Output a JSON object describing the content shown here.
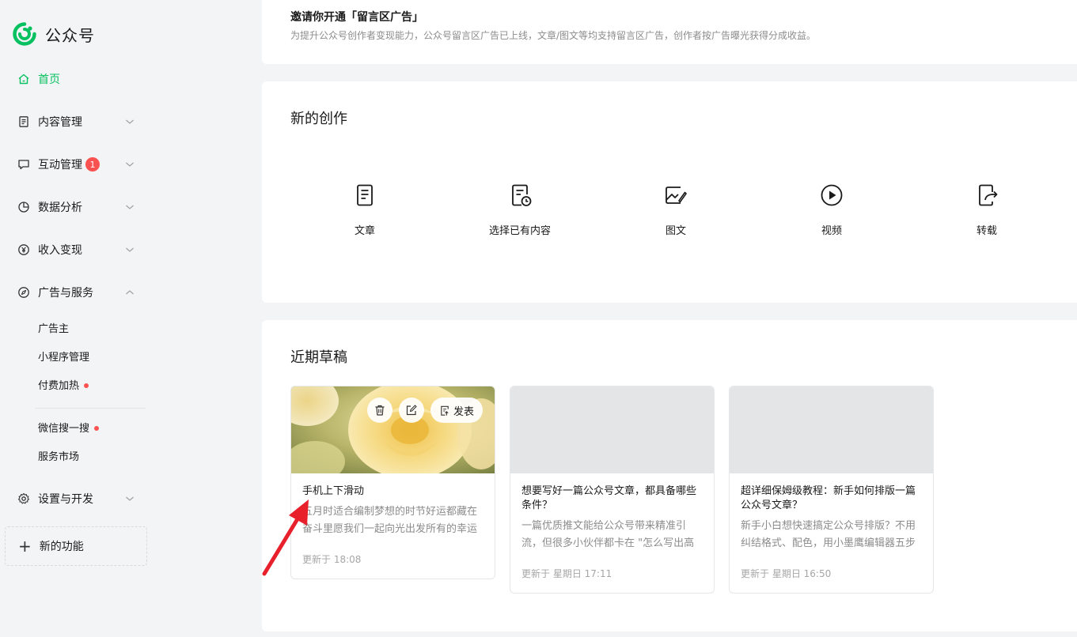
{
  "brand": {
    "name": "公众号",
    "color": "#07c160"
  },
  "sidebar": {
    "items": [
      {
        "label": "首页",
        "icon": "home-icon",
        "active": true
      },
      {
        "label": "内容管理",
        "icon": "document-icon"
      },
      {
        "label": "互动管理",
        "icon": "chat-icon",
        "badge": "1"
      },
      {
        "label": "数据分析",
        "icon": "pie-chart-icon"
      },
      {
        "label": "收入变现",
        "icon": "yuan-icon"
      },
      {
        "label": "广告与服务",
        "icon": "compass-icon",
        "expanded": true
      },
      {
        "label": "设置与开发",
        "icon": "gear-icon"
      }
    ],
    "subitems": [
      {
        "label": "广告主"
      },
      {
        "label": "小程序管理"
      },
      {
        "label": "付费加热",
        "dot": true
      },
      {
        "label": "微信搜一搜",
        "dot": true
      },
      {
        "label": "服务市场"
      }
    ],
    "new_feature": "新的功能"
  },
  "invite": {
    "title": "邀请你开通「留言区广告」",
    "desc": "为提升公众号创作者变现能力，公众号留言区广告已上线，文章/图文等均支持留言区广告，创作者按广告曝光获得分成收益。"
  },
  "create": {
    "title": "新的创作",
    "items": [
      {
        "label": "文章",
        "icon": "article-icon"
      },
      {
        "label": "选择已有内容",
        "icon": "existing-content-icon"
      },
      {
        "label": "图文",
        "icon": "image-text-icon"
      },
      {
        "label": "视频",
        "icon": "video-play-icon"
      },
      {
        "label": "转载",
        "icon": "repost-icon"
      }
    ]
  },
  "drafts": {
    "title": "近期草稿",
    "publish_label": "发表",
    "cards": [
      {
        "title": "手机上下滑动",
        "desc": "五月时适合编制梦想的时节好运都藏在奋斗里愿我们一起向光出发所有的幸运都...",
        "time": "更新于 18:08"
      },
      {
        "title": "想要写好一篇公众号文章，都具备哪些条件？",
        "desc": "一篇优质推文能给公众号带来精准引流，但很多小伙伴都卡在 \"怎么写出高质量...",
        "time": "更新于 星期日 17:11"
      },
      {
        "title": "超详细保姆级教程：新手如何排版一篇公众号文章？",
        "desc": "新手小白想快速搞定公众号排版？不用纠结格式、配色，用小墨鹰编辑器五步就...",
        "time": "更新于 星期日 16:50"
      }
    ]
  },
  "colors": {
    "accent": "#07c160",
    "badge": "#fa5151",
    "annotation_arrow": "#e8202b"
  }
}
